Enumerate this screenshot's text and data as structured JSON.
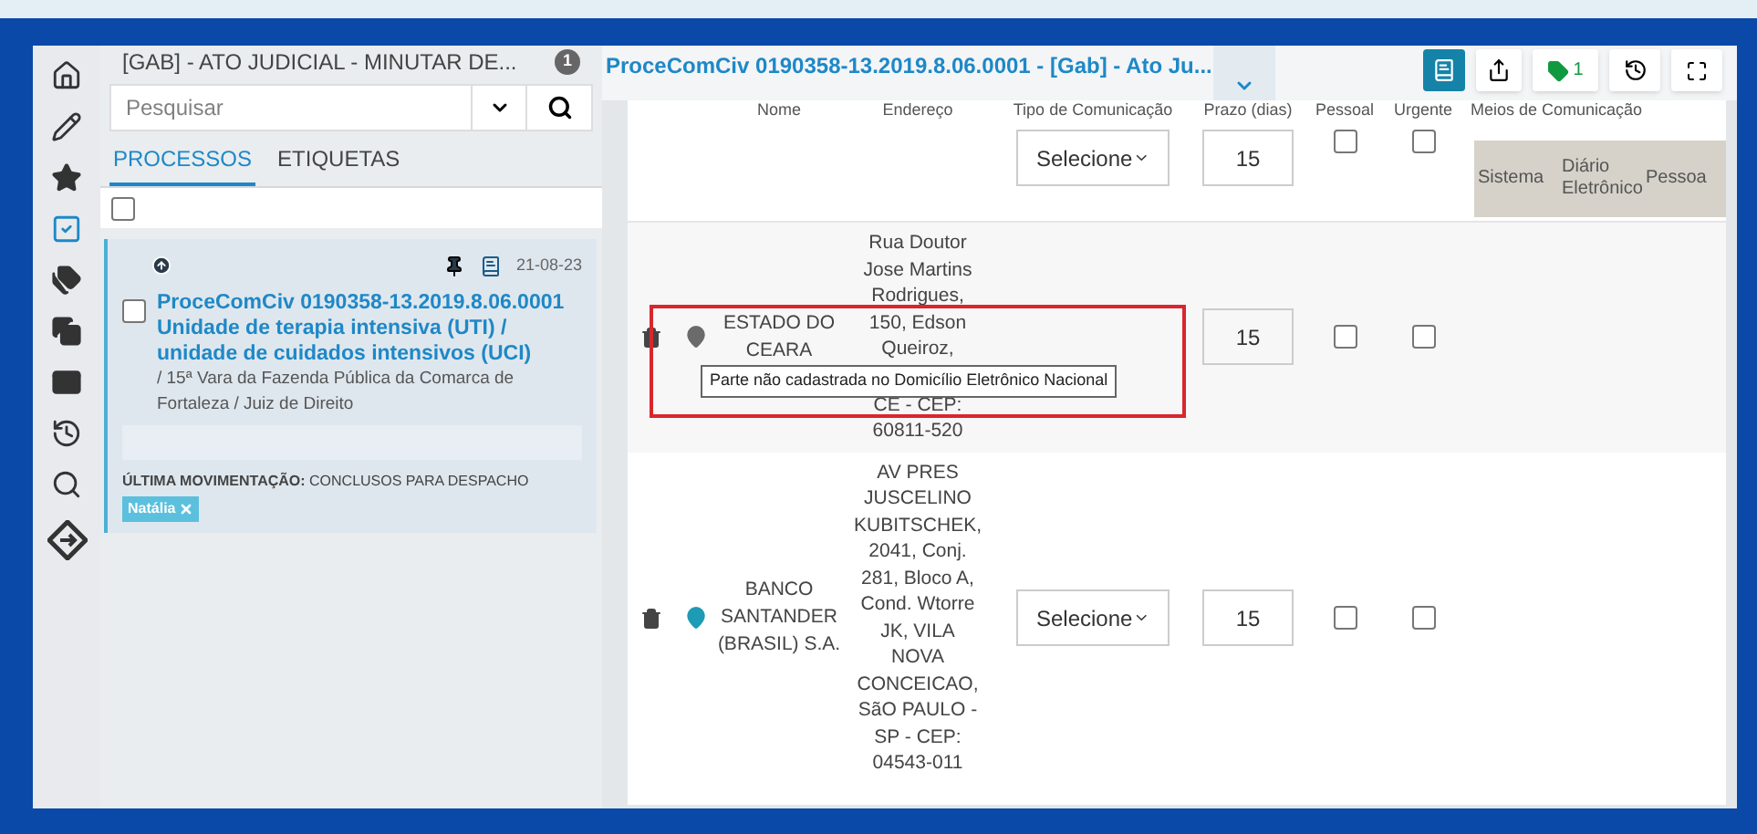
{
  "sidebar": {
    "title": "[GAB] - ATO JUDICIAL - MINUTAR DE...",
    "badge": "1",
    "search": {
      "placeholder": "Pesquisar"
    },
    "tabs": [
      {
        "label": "PROCESSOS",
        "selected": true
      },
      {
        "label": "ETIQUETAS",
        "selected": false
      }
    ],
    "select_all": {
      "checked": false
    },
    "card": {
      "date": "21-08-23",
      "checked": false,
      "title": "ProceComCiv 0190358-13.2019.8.06.0001",
      "subtitle": "Unidade de terapia intensiva (UTI) / unidade de cuidados intensivos (UCI)",
      "details": "/ 15ª Vara da Fazenda Pública da Comarca de Fortaleza / Juiz de Direito",
      "movement_label": "ÚLTIMA MOVIMENTAÇÃO:",
      "movement": "CONCLUSOS PARA DESPACHO",
      "tags": [
        {
          "label": "Natália"
        }
      ]
    }
  },
  "main": {
    "title": "ProceComCiv 0190358-13.2019.8.06.0001 - [Gab] - Ato Ju...",
    "tag_count": "1",
    "columns": [
      "Nome",
      "Endereço",
      "Tipo de Comunicação",
      "Prazo (dias)",
      "Pessoal",
      "Urgente",
      "Meios de Comunicação"
    ],
    "rows": [
      {
        "kind": "top",
        "select": "Selecione",
        "prazo": "15",
        "pessoal": false,
        "urgente": false,
        "meios_columns": [
          "Sistema",
          "Diário Eletrônico",
          "Pessoa"
        ]
      },
      {
        "kind": "party",
        "name": "ESTADO DO CEARA",
        "address_top": "Rua Doutor Jose Martins Rodrigues, 150, Edson Queiroz,",
        "address_bottom": "CE - CEP: 60811-520",
        "prazo": "15",
        "pessoal": false,
        "urgente": false,
        "color": "#6b6b6b",
        "highlighted": true,
        "tooltip": "Parte não cadastrada no Domicílio Eletrônico Nacional"
      },
      {
        "kind": "party",
        "name": "BANCO SANTANDER (BRASIL) S.A.",
        "address_top": "AV PRES JUSCELINO KUBITSCHEK, 2041, Conj. 281, Bloco A, Cond. Wtorre JK, VILA NOVA CONCEICAO, SãO PAULO - SP - CEP: 04543-011",
        "select": "Selecione",
        "prazo": "15",
        "pessoal": false,
        "urgente": false,
        "color": "#1e9bb5",
        "highlighted": false
      }
    ]
  }
}
